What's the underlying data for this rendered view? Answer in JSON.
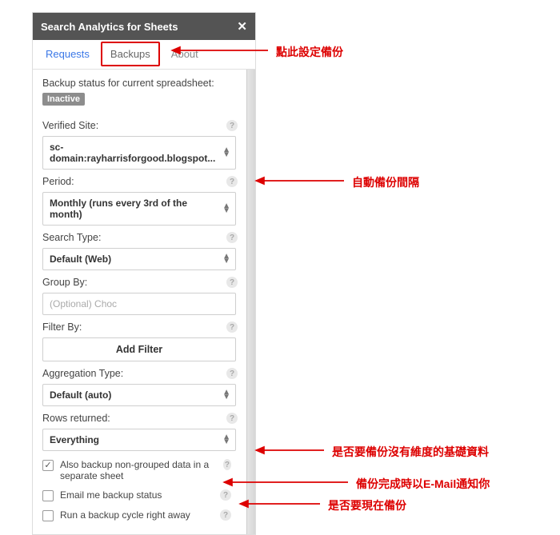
{
  "header": {
    "title": "Search Analytics for Sheets"
  },
  "tabs": {
    "requests": "Requests",
    "backups": "Backups",
    "about": "About"
  },
  "status": {
    "line": "Backup status for current spreadsheet:",
    "badge": "Inactive"
  },
  "fields": {
    "verified_site": {
      "label": "Verified Site:",
      "value": "sc-domain:rayharrisforgood.blogspot..."
    },
    "period": {
      "label": "Period:",
      "value": "Monthly (runs every 3rd of the month)"
    },
    "search_type": {
      "label": "Search Type:",
      "value": "Default (Web)"
    },
    "group_by": {
      "label": "Group By:",
      "placeholder": "(Optional) Choc"
    },
    "filter_by": {
      "label": "Filter By:"
    },
    "add_filter": "Add Filter",
    "aggregation": {
      "label": "Aggregation Type:",
      "value": "Default (auto)"
    },
    "rows": {
      "label": "Rows returned:",
      "value": "Everything"
    }
  },
  "checkboxes": {
    "non_grouped": "Also backup non-grouped data in a separate sheet",
    "email": "Email me backup status",
    "run_now": "Run a backup cycle right away"
  },
  "annotations": {
    "a1": "點此設定備份",
    "a2": "自動備份間隔",
    "a3": "是否要備份沒有維度的基礎資料",
    "a4": "備份完成時以E-Mail通知你",
    "a5": "是否要現在備份"
  }
}
